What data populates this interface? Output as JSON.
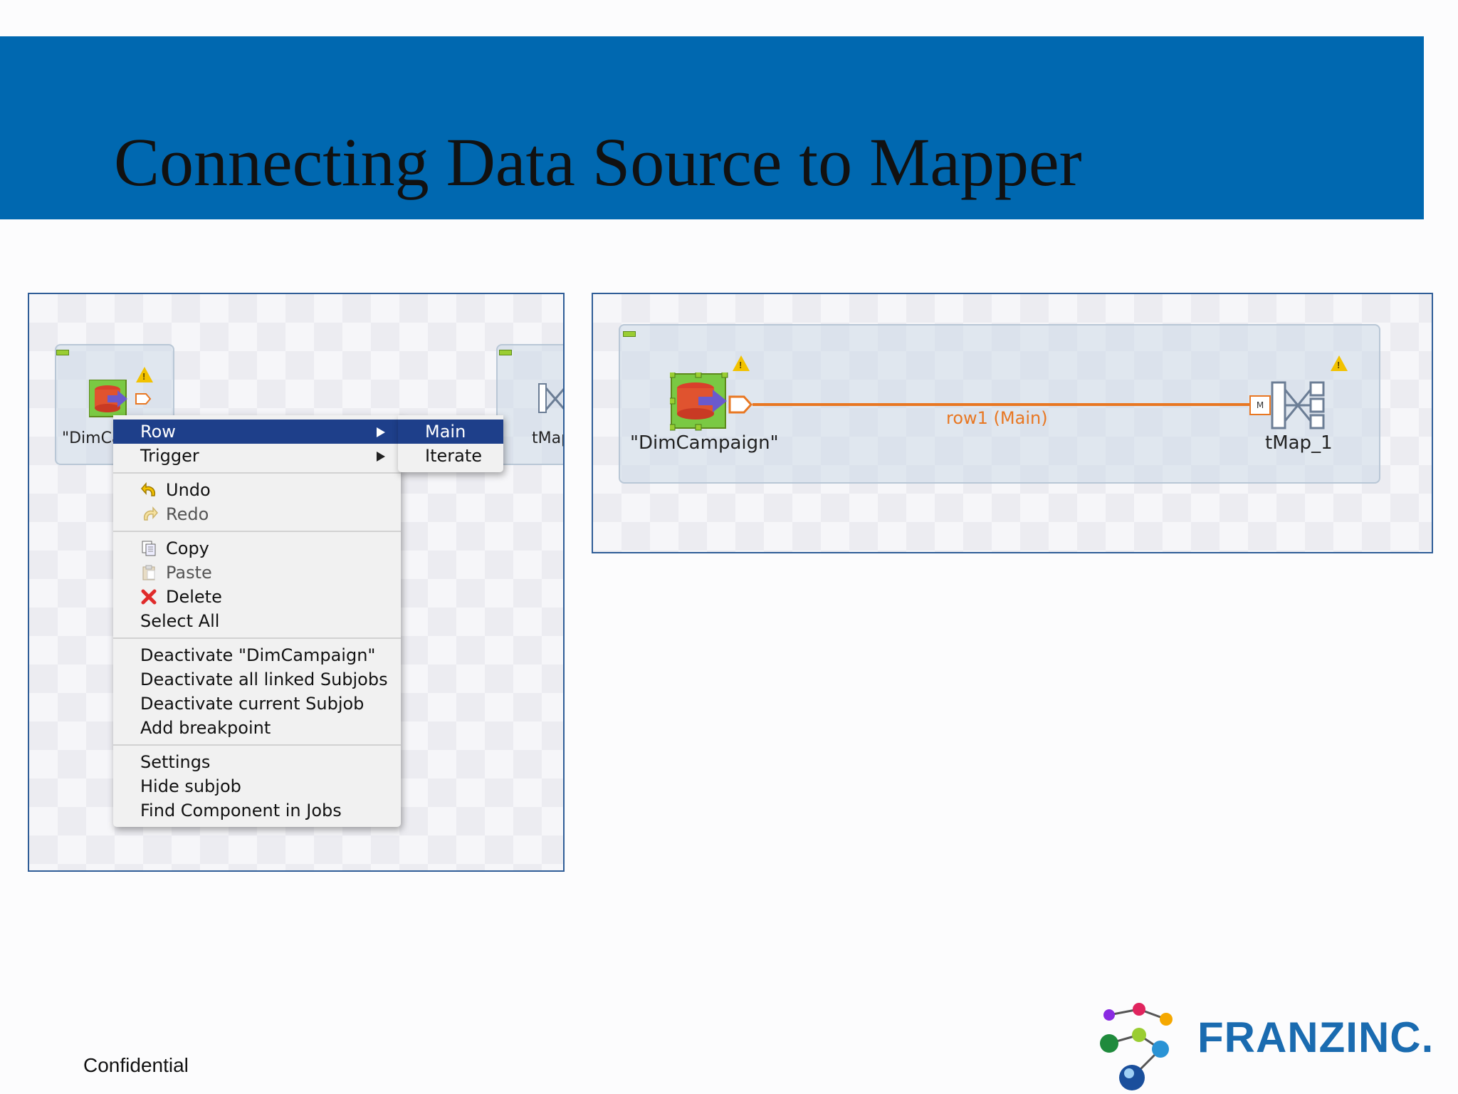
{
  "slide": {
    "title": "Connecting Data Source to Mapper",
    "footer": "Confidential",
    "logo_text": "FranzInc."
  },
  "left_panel": {
    "source_label_partial": "\"DimCa",
    "target_label_partial": "tMap",
    "context_menu": {
      "groups": [
        [
          {
            "label": "Row",
            "submenu": true,
            "active": true
          },
          {
            "label": "Trigger",
            "submenu": true
          }
        ],
        [
          {
            "label": "Undo",
            "icon": "undo-icon"
          },
          {
            "label": "Redo",
            "icon": "redo-icon",
            "disabled": true
          }
        ],
        [
          {
            "label": "Copy",
            "icon": "copy-icon"
          },
          {
            "label": "Paste",
            "icon": "paste-icon",
            "disabled": true
          },
          {
            "label": "Delete",
            "icon": "delete-icon"
          },
          {
            "label": "Select All"
          }
        ],
        [
          {
            "label": "Deactivate \"DimCampaign\""
          },
          {
            "label": "Deactivate all linked Subjobs"
          },
          {
            "label": "Deactivate current Subjob"
          },
          {
            "label": "Add breakpoint"
          }
        ],
        [
          {
            "label": "Settings"
          },
          {
            "label": "Hide subjob"
          },
          {
            "label": "Find Component in Jobs"
          }
        ]
      ],
      "submenu": [
        {
          "label": "Main",
          "active": true
        },
        {
          "label": "Iterate"
        }
      ]
    }
  },
  "right_panel": {
    "source_label": "\"DimCampaign\"",
    "connection_label": "row1 (Main)",
    "connection_input_badge": "M",
    "target_label": "tMap_1"
  },
  "colors": {
    "title_band": "#0068b0",
    "menu_highlight": "#1e3f8a",
    "connection": "#e87722",
    "component_green": "#7ac943",
    "logo_blue": "#1a6bb0"
  }
}
